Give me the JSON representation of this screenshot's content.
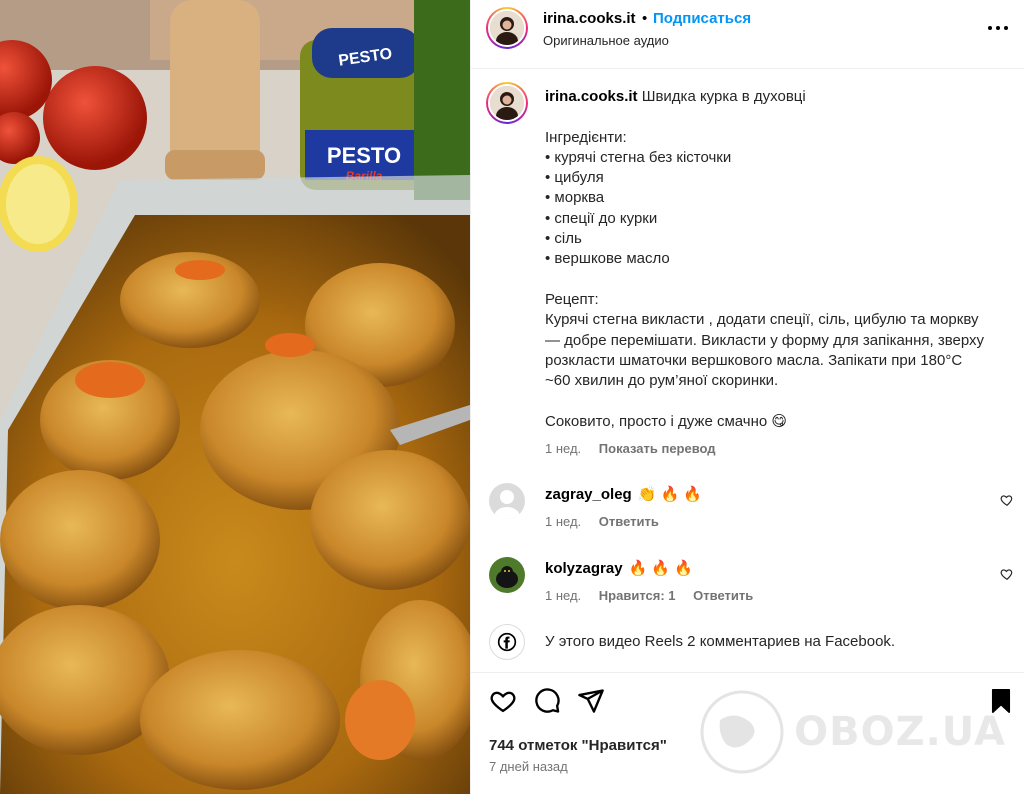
{
  "header": {
    "username": "irina.cooks.it",
    "separator": "•",
    "follow_label": "Подписаться",
    "audio_label": "Оригинальное аудио"
  },
  "media": {
    "jar_label_top": "PESTO",
    "jar_label_bottom": "PESTO",
    "jar_brand": "Barilla"
  },
  "caption": {
    "username": "irina.cooks.it",
    "title": "Швидка курка в духовці",
    "lines": [
      "Інгредієнти:",
      "• курячі стегна без кісточки",
      "• цибуля",
      "• морква",
      "• спеції до курки",
      "• сіль",
      "• вершкове масло",
      "",
      "Рецепт:",
      "Курячі стегна викласти , додати спеції, сіль, цибулю та моркву",
      "— добре перемішати. Викласти у форму для запікання, зверху",
      "розкласти шматочки вершкового масла. Запікати при 180°C",
      "~60 хвилин до рум’яної скоринки.",
      "",
      "Соковито, просто і дуже смачно 😋"
    ],
    "time": "1 нед.",
    "translate_label": "Показать перевод"
  },
  "comments": [
    {
      "username": "zagray_oleg",
      "text": "👏 🔥 🔥",
      "time": "1 нед.",
      "reply_label": "Ответить"
    },
    {
      "username": "kolyzagray",
      "text": "🔥 🔥 🔥",
      "time": "1 нед.",
      "likes_label": "Нравится: 1",
      "reply_label": "Ответить"
    }
  ],
  "facebook_note": "У этого видео Reels 2 комментариев на Facebook.",
  "footer": {
    "likes": "744 отметок \"Нравится\"",
    "date": "7 дней назад"
  },
  "watermark": "OBOZ.UA",
  "colors": {
    "accent": "#0095f6",
    "muted": "#737373",
    "divider": "#efefef",
    "fire": "#ff5a1f"
  }
}
